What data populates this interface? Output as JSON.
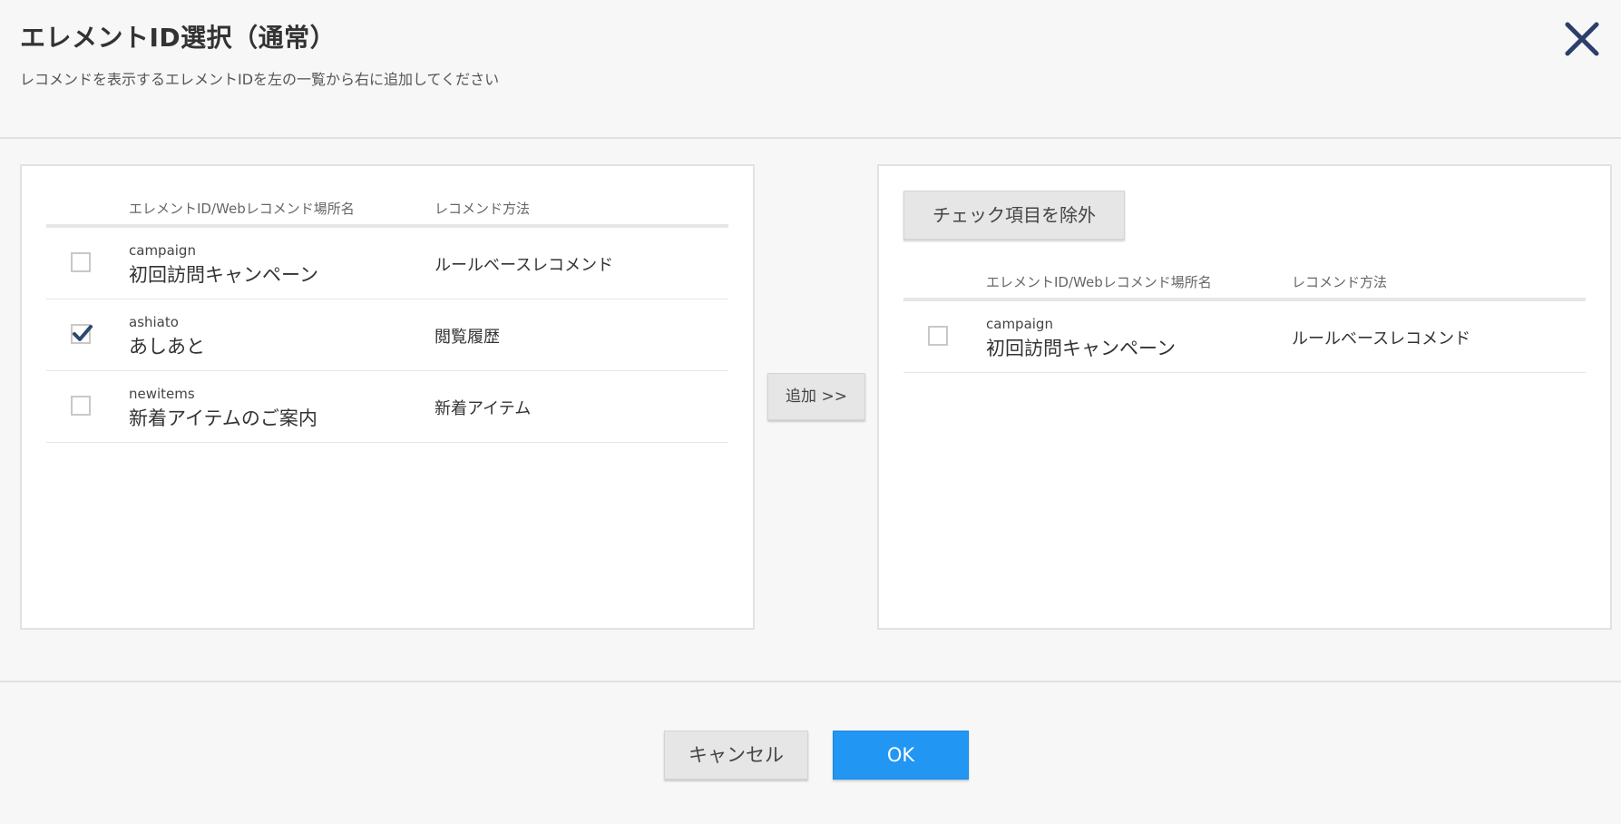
{
  "dialog": {
    "title": "エレメントID選択（通常）",
    "description": "レコメンドを表示するエレメントIDを左の一覧から右に追加してください",
    "close_icon": "close-icon",
    "close_color": "#2c3e6b"
  },
  "left_table": {
    "col_name": "エレメントID/Webレコメンド場所名",
    "col_method": "レコメンド方法",
    "rows": [
      {
        "id": "campaign",
        "name": "初回訪問キャンペーン",
        "method": "ルールベースレコメンド",
        "checked": false
      },
      {
        "id": "ashiato",
        "name": "あしあと",
        "method": "閲覧履歴",
        "checked": true
      },
      {
        "id": "newitems",
        "name": "新着アイテムのご案内",
        "method": "新着アイテム",
        "checked": false
      }
    ]
  },
  "add_button": "追加 >>",
  "right_panel": {
    "remove_button": "チェック項目を除外",
    "col_name": "エレメントID/Webレコメンド場所名",
    "col_method": "レコメンド方法",
    "rows": [
      {
        "id": "campaign",
        "name": "初回訪問キャンペーン",
        "method": "ルールベースレコメンド",
        "checked": false
      }
    ]
  },
  "footer": {
    "cancel": "キャンセル",
    "ok": "OK"
  },
  "colors": {
    "primary": "#2196f3",
    "checkmark": "#2c4a6e"
  }
}
